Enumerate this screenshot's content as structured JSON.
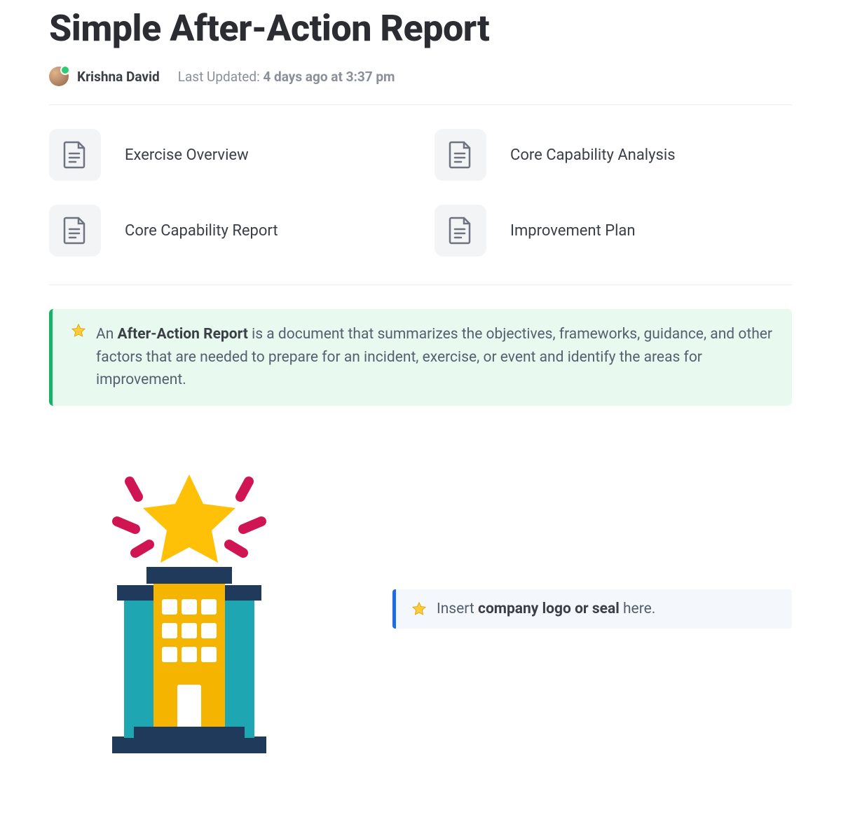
{
  "title": "Simple After-Action Report",
  "author": "Krishna David",
  "last_updated_prefix": "Last Updated: ",
  "last_updated_value": "4 days ago at 3:37 pm",
  "nav": [
    {
      "label": "Exercise Overview"
    },
    {
      "label": "Core Capability Analysis"
    },
    {
      "label": "Core Capability Report"
    },
    {
      "label": "Improvement Plan"
    }
  ],
  "callout": {
    "lead": "An ",
    "bold": "After-Action Report",
    "rest": " is a document that summarizes the objectives, frameworks, guidance, and other factors that are needed to prepare for an incident, exercise, or event and identify the areas for improvement."
  },
  "logo_note": {
    "lead": "Insert ",
    "bold": "company logo or seal",
    "rest": " here."
  },
  "colors": {
    "accent_green": "#17b26a",
    "accent_blue": "#1e6de6",
    "building_yellow": "#f5b400",
    "building_dark": "#1f3a5a",
    "building_cyan": "#1ea7b2",
    "spark_magenta": "#cf1653"
  }
}
